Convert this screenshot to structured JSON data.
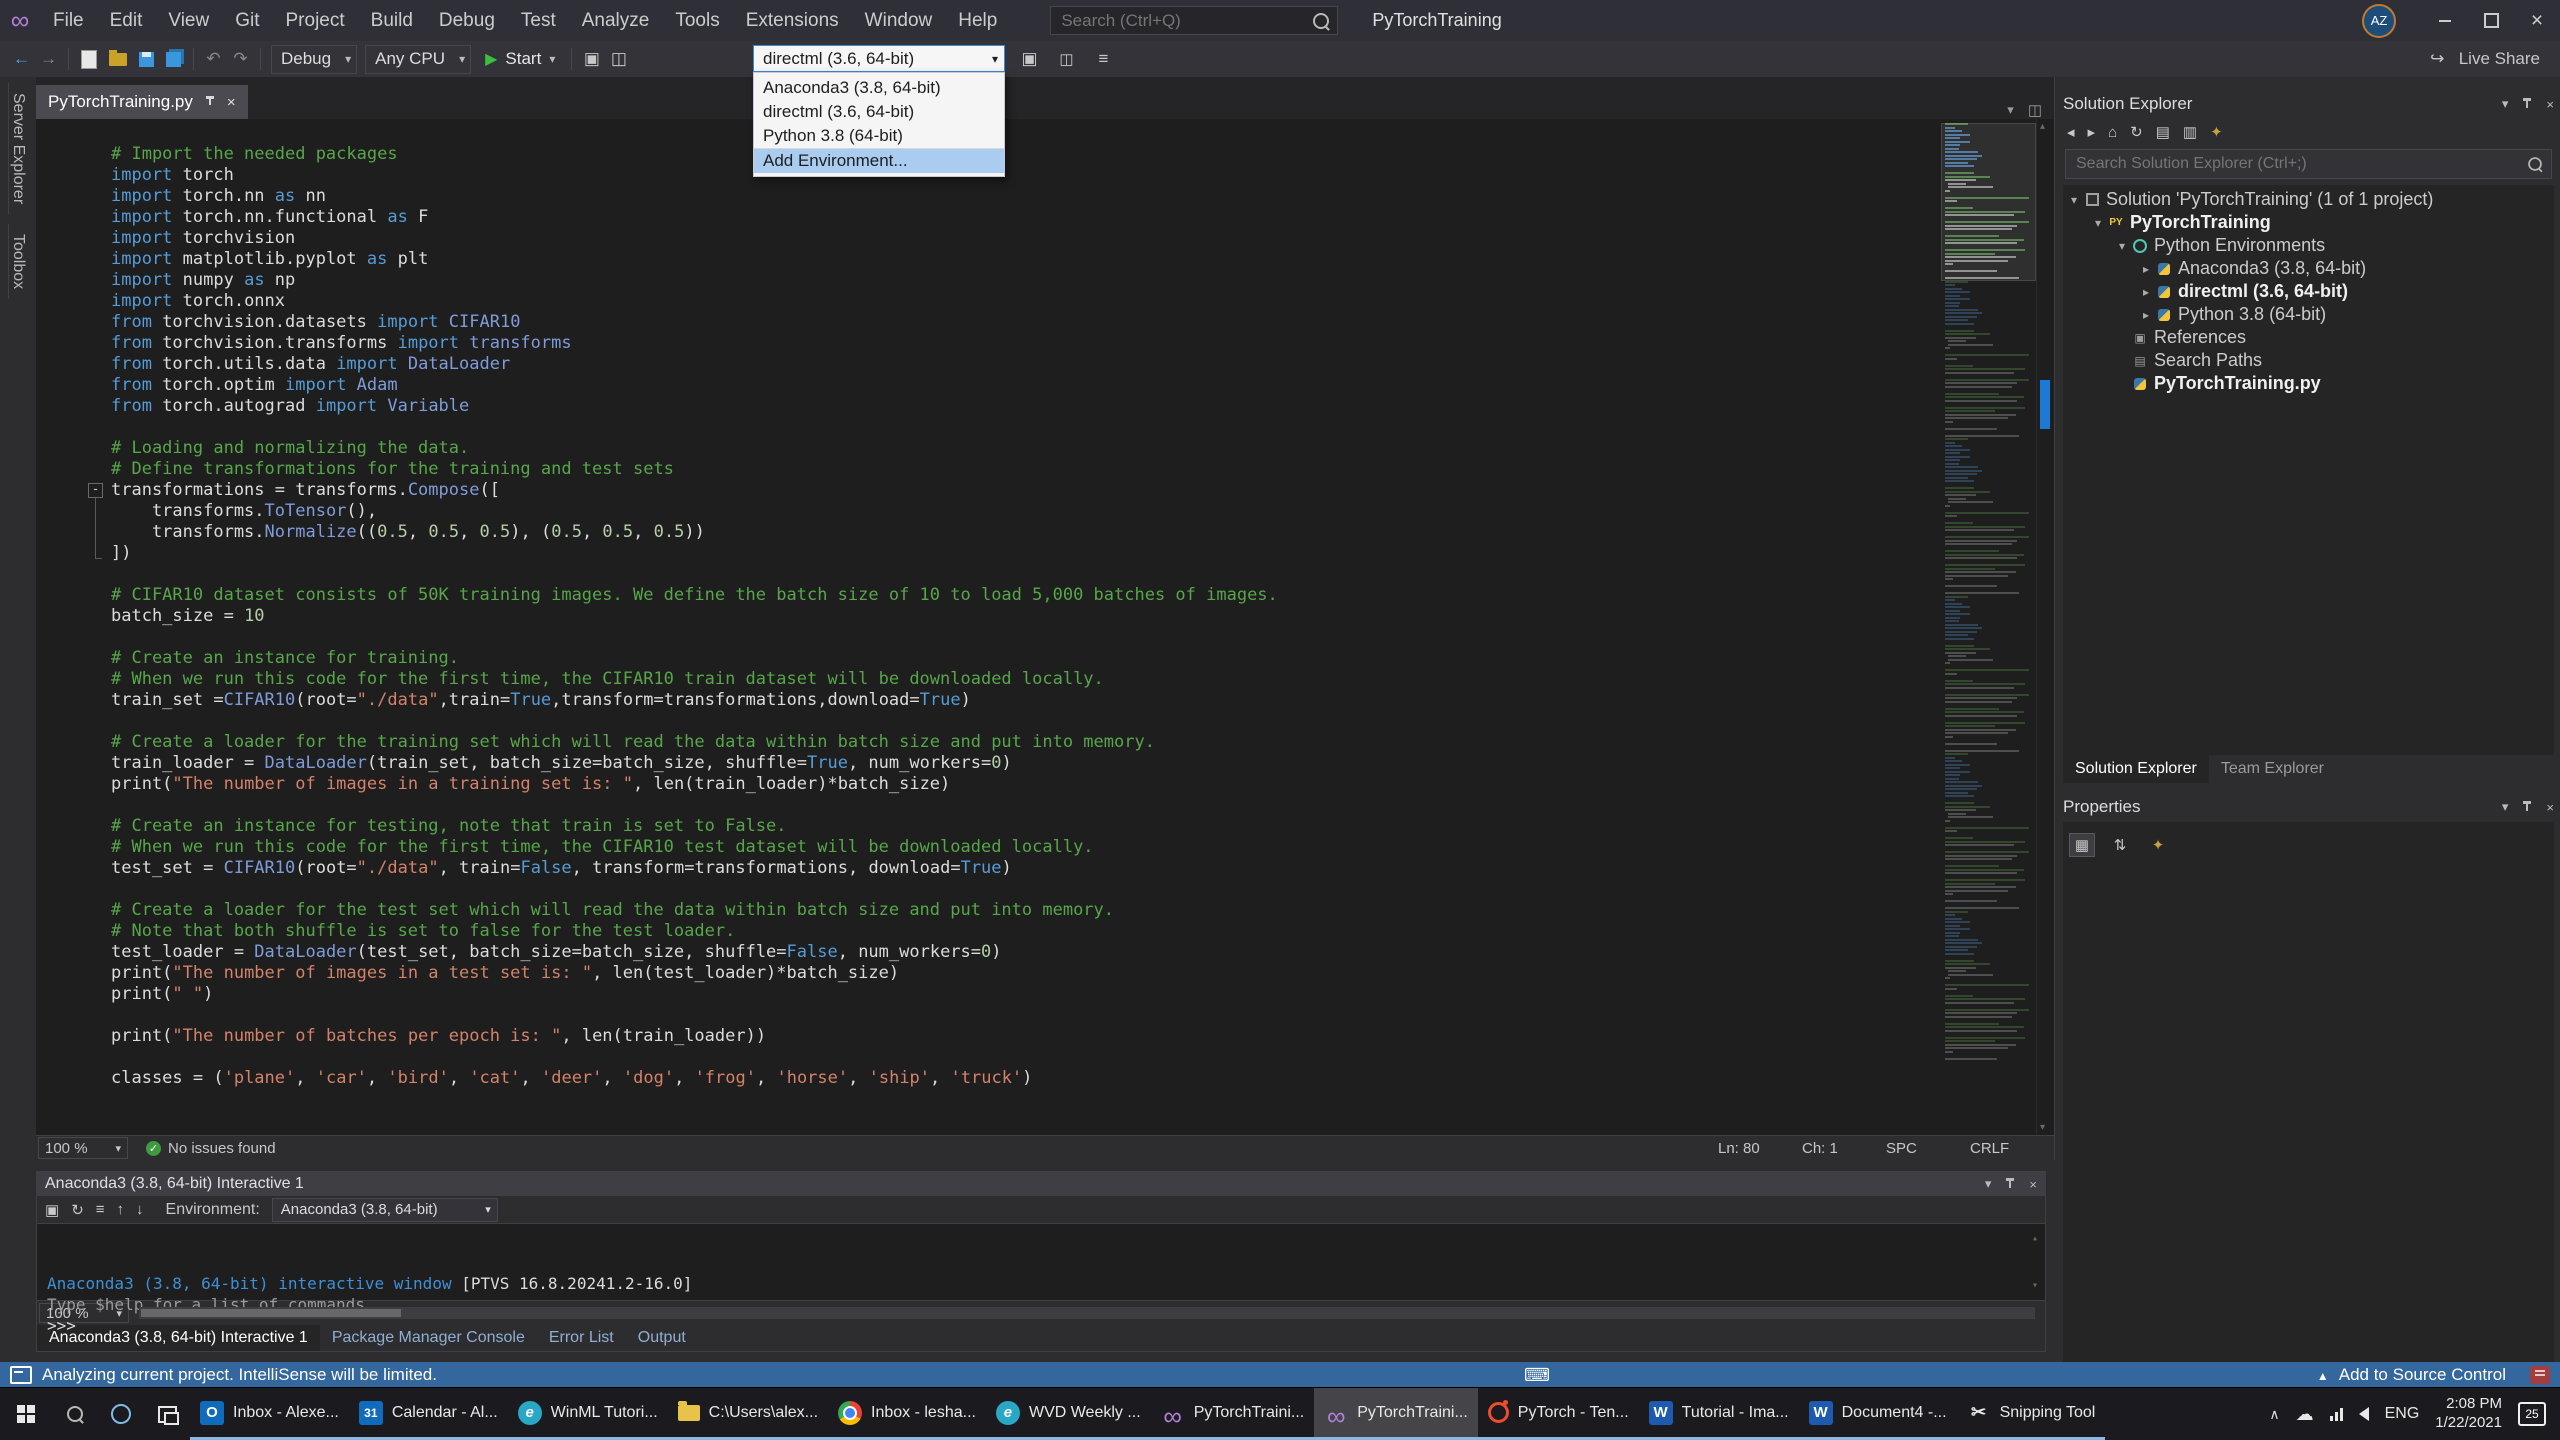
{
  "titlebar": {
    "menus": [
      "File",
      "Edit",
      "View",
      "Git",
      "Project",
      "Build",
      "Debug",
      "Test",
      "Analyze",
      "Tools",
      "Extensions",
      "Window",
      "Help"
    ],
    "search_placeholder": "Search (Ctrl+Q)",
    "window_title": "PyTorchTraining",
    "avatar": "AZ"
  },
  "toolbar": {
    "debug_config": "Debug",
    "platform": "Any CPU",
    "start_label": "Start",
    "env_combo": "directml (3.6, 64-bit)",
    "live_share": "Live Share"
  },
  "env_dropdown": {
    "items": [
      "Anaconda3 (3.8, 64-bit)",
      "directml (3.6, 64-bit)",
      "Python 3.8 (64-bit)",
      "Add Environment..."
    ],
    "highlighted_index": 3
  },
  "left_strip": [
    "Server Explorer",
    "Toolbox"
  ],
  "editor": {
    "tab_title": "PyTorchTraining.py",
    "fold_line_index": 16,
    "status": {
      "zoom": "100 %",
      "message": "No issues found",
      "ln": "Ln: 80",
      "ch": "Ch: 1",
      "encoding": "SPC",
      "eol": "CRLF"
    },
    "lines": [
      [
        [
          "c",
          "# Import the needed packages"
        ]
      ],
      [
        [
          "k",
          "import"
        ],
        [
          "d",
          " torch"
        ]
      ],
      [
        [
          "k",
          "import"
        ],
        [
          "d",
          " torch.nn "
        ],
        [
          "k",
          "as"
        ],
        [
          "d",
          " nn"
        ]
      ],
      [
        [
          "k",
          "import"
        ],
        [
          "d",
          " torch.nn.functional "
        ],
        [
          "k",
          "as"
        ],
        [
          "d",
          " F"
        ]
      ],
      [
        [
          "k",
          "import"
        ],
        [
          "d",
          " torchvision"
        ]
      ],
      [
        [
          "k",
          "import"
        ],
        [
          "d",
          " matplotlib.pyplot "
        ],
        [
          "k",
          "as"
        ],
        [
          "d",
          " plt"
        ]
      ],
      [
        [
          "k",
          "import"
        ],
        [
          "d",
          " numpy "
        ],
        [
          "k",
          "as"
        ],
        [
          "d",
          " np"
        ]
      ],
      [
        [
          "k",
          "import"
        ],
        [
          "d",
          " torch.onnx"
        ]
      ],
      [
        [
          "k",
          "from"
        ],
        [
          "d",
          " torchvision.datasets "
        ],
        [
          "k",
          "import"
        ],
        [
          "t",
          " CIFAR10"
        ]
      ],
      [
        [
          "k",
          "from"
        ],
        [
          "d",
          " torchvision.transforms "
        ],
        [
          "k",
          "import"
        ],
        [
          "t",
          " transforms"
        ]
      ],
      [
        [
          "k",
          "from"
        ],
        [
          "d",
          " torch.utils.data "
        ],
        [
          "k",
          "import"
        ],
        [
          "t",
          " DataLoader"
        ]
      ],
      [
        [
          "k",
          "from"
        ],
        [
          "d",
          " torch.optim "
        ],
        [
          "k",
          "import"
        ],
        [
          "t",
          " Adam"
        ]
      ],
      [
        [
          "k",
          "from"
        ],
        [
          "d",
          " torch.autograd "
        ],
        [
          "k",
          "import"
        ],
        [
          "t",
          " Variable"
        ]
      ],
      [],
      [
        [
          "c",
          "# Loading and normalizing the data."
        ]
      ],
      [
        [
          "c",
          "# Define transformations for the training and test sets"
        ]
      ],
      [
        [
          "d",
          "transformations = transforms."
        ],
        [
          "t",
          "Compose"
        ],
        [
          "d",
          "(["
        ]
      ],
      [
        [
          "d",
          "    transforms."
        ],
        [
          "t",
          "ToTensor"
        ],
        [
          "d",
          "(),"
        ]
      ],
      [
        [
          "d",
          "    transforms."
        ],
        [
          "t",
          "Normalize"
        ],
        [
          "d",
          "(("
        ],
        [
          "n",
          "0.5"
        ],
        [
          "d",
          ", "
        ],
        [
          "n",
          "0.5"
        ],
        [
          "d",
          ", "
        ],
        [
          "n",
          "0.5"
        ],
        [
          "d",
          "), ("
        ],
        [
          "n",
          "0.5"
        ],
        [
          "d",
          ", "
        ],
        [
          "n",
          "0.5"
        ],
        [
          "d",
          ", "
        ],
        [
          "n",
          "0.5"
        ],
        [
          "d",
          "))"
        ]
      ],
      [
        [
          "d",
          "])"
        ]
      ],
      [],
      [
        [
          "c",
          "# CIFAR10 dataset consists of 50K training images. We define the batch size of 10 to load 5,000 batches of images."
        ]
      ],
      [
        [
          "d",
          "batch_size = "
        ],
        [
          "n",
          "10"
        ]
      ],
      [],
      [
        [
          "c",
          "# Create an instance for training."
        ]
      ],
      [
        [
          "c",
          "# When we run this code for the first time, the CIFAR10 train dataset will be downloaded locally."
        ]
      ],
      [
        [
          "d",
          "train_set ="
        ],
        [
          "t",
          "CIFAR10"
        ],
        [
          "d",
          "(root="
        ],
        [
          "s",
          "\"./data\""
        ],
        [
          "d",
          ",train="
        ],
        [
          "k",
          "True"
        ],
        [
          "d",
          ",transform=transformations,download="
        ],
        [
          "k",
          "True"
        ],
        [
          "d",
          ")"
        ]
      ],
      [],
      [
        [
          "c",
          "# Create a loader for the training set which will read the data within batch size and put into memory."
        ]
      ],
      [
        [
          "d",
          "train_loader = "
        ],
        [
          "t",
          "DataLoader"
        ],
        [
          "d",
          "(train_set, batch_size=batch_size, shuffle="
        ],
        [
          "k",
          "True"
        ],
        [
          "d",
          ", num_workers="
        ],
        [
          "n",
          "0"
        ],
        [
          "d",
          ")"
        ]
      ],
      [
        [
          "d",
          "print("
        ],
        [
          "s",
          "\"The number of images in a training set is: \""
        ],
        [
          "d",
          ", len(train_loader)*batch_size)"
        ]
      ],
      [],
      [
        [
          "c",
          "# Create an instance for testing, note that train is set to False."
        ]
      ],
      [
        [
          "c",
          "# When we run this code for the first time, the CIFAR10 test dataset will be downloaded locally."
        ]
      ],
      [
        [
          "d",
          "test_set = "
        ],
        [
          "t",
          "CIFAR10"
        ],
        [
          "d",
          "(root="
        ],
        [
          "s",
          "\"./data\""
        ],
        [
          "d",
          ", train="
        ],
        [
          "k",
          "False"
        ],
        [
          "d",
          ", transform=transformations, download="
        ],
        [
          "k",
          "True"
        ],
        [
          "d",
          ")"
        ]
      ],
      [],
      [
        [
          "c",
          "# Create a loader for the test set which will read the data within batch size and put into memory."
        ]
      ],
      [
        [
          "c",
          "# Note that both shuffle is set to false for the test loader."
        ]
      ],
      [
        [
          "d",
          "test_loader = "
        ],
        [
          "t",
          "DataLoader"
        ],
        [
          "d",
          "(test_set, batch_size=batch_size, shuffle="
        ],
        [
          "k",
          "False"
        ],
        [
          "d",
          ", num_workers="
        ],
        [
          "n",
          "0"
        ],
        [
          "d",
          ")"
        ]
      ],
      [
        [
          "d",
          "print("
        ],
        [
          "s",
          "\"The number of images in a test set is: \""
        ],
        [
          "d",
          ", len(test_loader)*batch_size)"
        ]
      ],
      [
        [
          "d",
          "print("
        ],
        [
          "s",
          "\" \""
        ],
        [
          "d",
          ")"
        ]
      ],
      [],
      [
        [
          "d",
          "print("
        ],
        [
          "s",
          "\"The number of batches per epoch is: \""
        ],
        [
          "d",
          ", len(train_loader))"
        ]
      ],
      [],
      [
        [
          "d",
          "classes = ("
        ],
        [
          "s",
          "'plane'"
        ],
        [
          "d",
          ", "
        ],
        [
          "s",
          "'car'"
        ],
        [
          "d",
          ", "
        ],
        [
          "s",
          "'bird'"
        ],
        [
          "d",
          ", "
        ],
        [
          "s",
          "'cat'"
        ],
        [
          "d",
          ", "
        ],
        [
          "s",
          "'deer'"
        ],
        [
          "d",
          ", "
        ],
        [
          "s",
          "'dog'"
        ],
        [
          "d",
          ", "
        ],
        [
          "s",
          "'frog'"
        ],
        [
          "d",
          ", "
        ],
        [
          "s",
          "'horse'"
        ],
        [
          "d",
          ", "
        ],
        [
          "s",
          "'ship'"
        ],
        [
          "d",
          ", "
        ],
        [
          "s",
          "'truck'"
        ],
        [
          "d",
          ")"
        ]
      ]
    ]
  },
  "solution_explorer": {
    "title": "Solution Explorer",
    "search_placeholder": "Search Solution Explorer (Ctrl+;)",
    "tree": [
      {
        "indent": 0,
        "expander": "exp",
        "icon": "solution",
        "label": "Solution 'PyTorchTraining' (1 of 1 project)"
      },
      {
        "indent": 1,
        "expander": "exp",
        "icon": "project",
        "label": "PyTorchTraining",
        "bold": true
      },
      {
        "indent": 2,
        "expander": "exp",
        "icon": "envs",
        "label": "Python Environments"
      },
      {
        "indent": 3,
        "expander": "col",
        "icon": "pyenv",
        "label": "Anaconda3 (3.8, 64-bit)"
      },
      {
        "indent": 3,
        "expander": "col",
        "icon": "pyenv",
        "label": "directml (3.6, 64-bit)",
        "bold": true
      },
      {
        "indent": 3,
        "expander": "col",
        "icon": "pyenv",
        "label": "Python 3.8 (64-bit)"
      },
      {
        "indent": 2,
        "expander": null,
        "icon": "refs",
        "label": "References"
      },
      {
        "indent": 2,
        "expander": null,
        "icon": "paths",
        "label": "Search Paths"
      },
      {
        "indent": 2,
        "expander": null,
        "icon": "pyfile",
        "label": "PyTorchTraining.py",
        "bold": true
      }
    ],
    "tabs": [
      {
        "label": "Solution Explorer",
        "active": true
      },
      {
        "label": "Team Explorer",
        "active": false
      }
    ]
  },
  "properties": {
    "title": "Properties"
  },
  "interactive": {
    "title": "Anaconda3 (3.8, 64-bit) Interactive 1",
    "env_label": "Environment:",
    "env_value": "Anaconda3 (3.8, 64-bit)",
    "zoom": "100 %",
    "lines": [
      [
        [
          "b",
          "Anaconda3 (3.8, 64-bit) interactive window "
        ],
        [
          "d",
          "[PTVS 16.8.20241.2-16.0]"
        ]
      ],
      [
        [
          "g",
          "Type $help for a list of commands."
        ]
      ],
      [
        [
          "d",
          ">>> "
        ]
      ]
    ],
    "tabs": [
      {
        "label": "Anaconda3 (3.8, 64-bit) Interactive 1",
        "active": true
      },
      {
        "label": "Package Manager Console",
        "active": false
      },
      {
        "label": "Error List",
        "active": false
      },
      {
        "label": "Output",
        "active": false
      }
    ]
  },
  "statusbar": {
    "message": "Analyzing current project. IntelliSense will be limited.",
    "source_control": "Add to Source Control"
  },
  "taskbar": {
    "items": [
      {
        "icon": "outlook",
        "label": "Inbox - Alexe...",
        "running": true
      },
      {
        "icon": "calendar",
        "label": "Calendar - Al...",
        "running": true
      },
      {
        "icon": "edge",
        "label": "WinML Tutori...",
        "running": true
      },
      {
        "icon": "folder",
        "label": "C:\\Users\\alex...",
        "running": true
      },
      {
        "icon": "chrome",
        "label": "Inbox - lesha...",
        "running": true
      },
      {
        "icon": "edge",
        "label": "WVD Weekly ...",
        "running": true
      },
      {
        "icon": "vs",
        "label": "PyTorchTraini...",
        "running": true
      },
      {
        "icon": "vs",
        "label": "PyTorchTraini...",
        "running": true,
        "active": true
      },
      {
        "icon": "pytorch",
        "label": "PyTorch - Ten...",
        "running": true
      },
      {
        "icon": "word",
        "label": "Tutorial - Ima...",
        "running": true
      },
      {
        "icon": "word",
        "label": "Document4 -...",
        "running": true
      },
      {
        "icon": "snip",
        "label": "Snipping Tool",
        "running": true
      }
    ],
    "tray": {
      "lang": "ENG",
      "time": "2:08 PM",
      "date": "1/22/2021",
      "badge": "25"
    }
  }
}
